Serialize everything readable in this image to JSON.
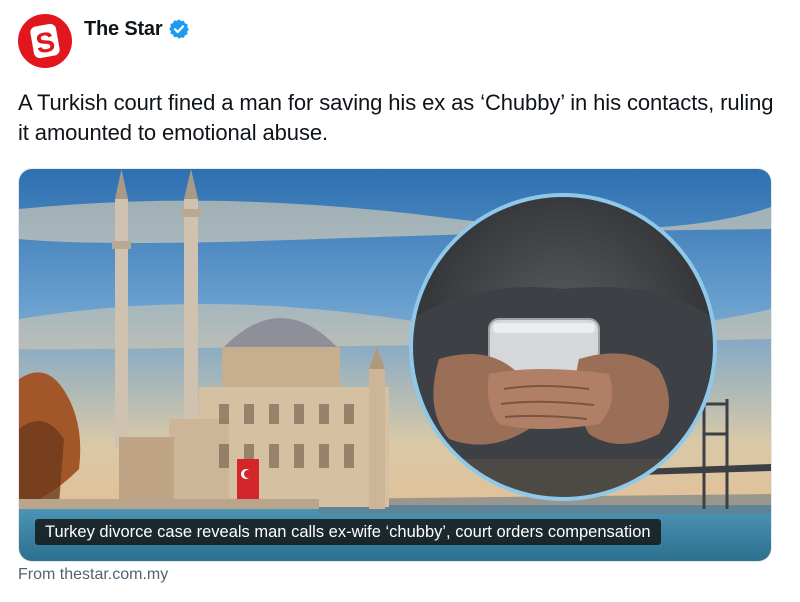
{
  "account": {
    "avatar_letter": "S",
    "name": "The Star",
    "verified_icon": "verified-badge-icon",
    "brand_color": "#e2161d",
    "verified_color": "#1d9bf0"
  },
  "tweet": {
    "text": "A Turkish court fined a man for saving his ex as ‘Chubby’ in his contacts, ruling it amounted to emotional abuse."
  },
  "card": {
    "caption": "Turkey divorce case reveals man calls ex-wife ‘chubby’, court orders compensation",
    "source": "From thestar.com.my"
  }
}
